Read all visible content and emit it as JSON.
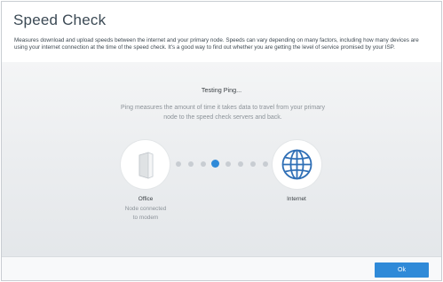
{
  "dialog": {
    "title": "Speed Check",
    "description": "Measures download and upload speeds between the internet and your primary node. Speeds can vary depending on many factors, including how many devices are using your internet connection at the time of the speed check. It's a good way to find out whether you are getting the level of service promised by your ISP."
  },
  "speed_check": {
    "status": "Testing Ping...",
    "info": "Ping measures the amount of time it takes data to travel from your primary node to the speed check servers and back.",
    "source_node": {
      "name": "Office",
      "status_line1": "Node connected",
      "status_line2": "to modem",
      "icon": "router-node-icon"
    },
    "destination_node": {
      "name": "Internet",
      "icon": "globe-icon"
    },
    "progress": {
      "dot_count": 8,
      "active_index": 3
    }
  },
  "footer": {
    "ok_label": "Ok"
  },
  "colors": {
    "accent": "#2f8ad8",
    "inactive_dot": "#c8cdd2",
    "title": "#3c4a55"
  }
}
